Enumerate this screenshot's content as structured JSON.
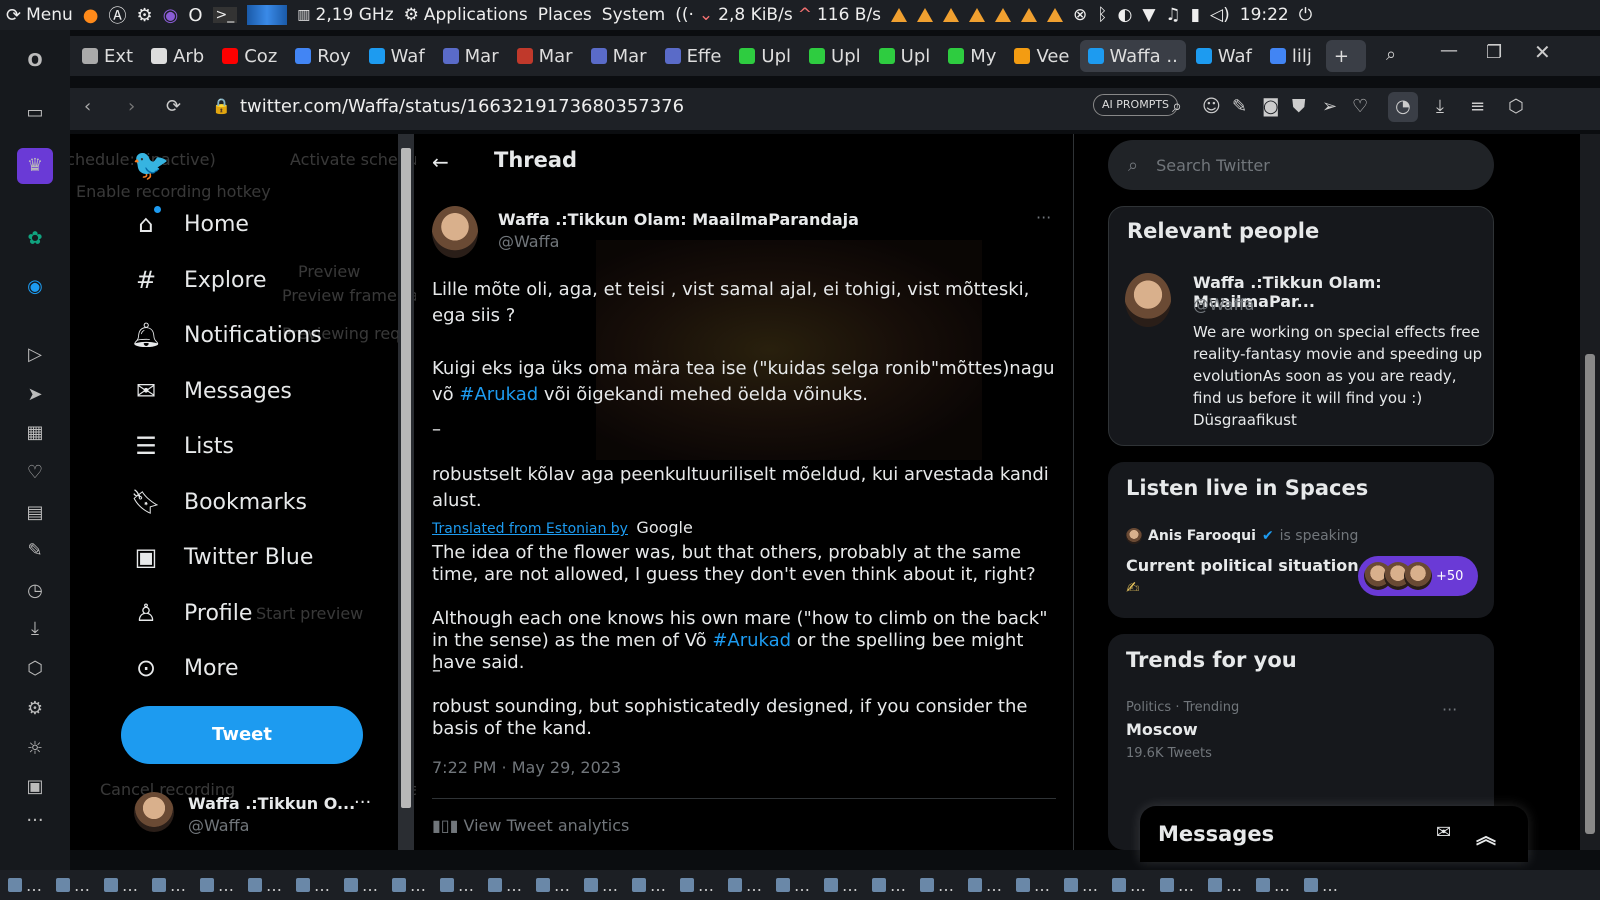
{
  "system_panel": {
    "menu_label": "Menu",
    "cpu_freq": "2,19 GHz",
    "applications_label": "Applications",
    "places_label": "Places",
    "system_label": "System",
    "net_down": "2,8 KiB/s",
    "net_up": "116 B/s",
    "clock": "19:22"
  },
  "browser": {
    "tabs": [
      {
        "label": "Ext",
        "color": "#aaaaaa"
      },
      {
        "label": "Arb",
        "color": "#dddddd"
      },
      {
        "label": "Coz",
        "color": "#ff0000"
      },
      {
        "label": "Roy",
        "color": "#4285f4"
      },
      {
        "label": "Waf",
        "color": "#1d9bf0"
      },
      {
        "label": "Mar",
        "color": "#5a6bc8"
      },
      {
        "label": "Mar",
        "color": "#c0392b"
      },
      {
        "label": "Mar",
        "color": "#5a6bc8"
      },
      {
        "label": "Effe",
        "color": "#5a6bc8"
      },
      {
        "label": "Upl",
        "color": "#2ecc40"
      },
      {
        "label": "Upl",
        "color": "#2ecc40"
      },
      {
        "label": "Upl",
        "color": "#2ecc40"
      },
      {
        "label": "My",
        "color": "#2ecc40"
      },
      {
        "label": "Vee",
        "color": "#f39c12"
      },
      {
        "label": "Waffa ..",
        "color": "#1d9bf0",
        "active": true
      },
      {
        "label": "Waf",
        "color": "#1d9bf0"
      },
      {
        "label": "lilj",
        "color": "#4285f4"
      }
    ],
    "url": "twitter.com/Waffa/status/1663219173680357376",
    "ai_prompts_label": "AI PROMPTS"
  },
  "twitter": {
    "nav": [
      {
        "label": "Home",
        "icon": "home-icon"
      },
      {
        "label": "Explore",
        "icon": "hashtag-icon"
      },
      {
        "label": "Notifications",
        "icon": "bell-icon"
      },
      {
        "label": "Messages",
        "icon": "envelope-icon"
      },
      {
        "label": "Lists",
        "icon": "list-icon"
      },
      {
        "label": "Bookmarks",
        "icon": "bookmark-icon"
      },
      {
        "label": "Twitter Blue",
        "icon": "twitter-blue-icon"
      },
      {
        "label": "Profile",
        "icon": "person-icon"
      },
      {
        "label": "More",
        "icon": "more-circle-icon"
      }
    ],
    "tweet_button": "Tweet",
    "account": {
      "name": "Waffa .:Tikkun O...",
      "handle": "@Waffa"
    },
    "thread": {
      "header": "Thread",
      "author_name": "Waffa .:Tikkun Olam: MaailmaParandaja",
      "author_handle": "@Waffa",
      "para1": "Lille mõte oli, aga, et teisi , vist samal ajal, ei tohigi, vist mõtteski, ega siis ?",
      "para2_before": "Kuigi eks iga üks oma mära tea ise (\"kuidas selga ronib\"mõttes)nagu võ ",
      "para2_hashtag": "#Arukad",
      "para2_after": " või õigekandi mehed öelda võinuks.",
      "dash1": "–",
      "para3": "robustselt kõlav aga peenkultuuriliselt mõeldud, kui arvestada kandi alust.",
      "translated_label": "Translated from Estonian by",
      "google_label": "Google",
      "tr1": "The idea of the flower was, but that others, probably at the same time, are not allowed, I guess they don't even think about it, right?",
      "tr2_before": "Although each one knows his own mare (\"how to climb on the back\" in the sense) as the men of Võ ",
      "tr2_hashtag": "#Arukad",
      "tr2_after": " or the spelling bee might have said.",
      "dash2": "–",
      "tr3": "robust sounding, but sophisticatedly designed, if you consider the basis of the kand.",
      "timestamp": "7:22 PM · May 29, 2023",
      "analytics": "View Tweet analytics"
    },
    "search_placeholder": "Search Twitter",
    "relevant": {
      "title": "Relevant people",
      "name": "Waffa .:Tikkun Olam: MaailmaPar...",
      "handle": "@Waffa",
      "bio": "We are working on special effects free reality-fantasy movie and speeding up evolutionAs soon as you are ready, find us before it will find you :) Düsgraafikust"
    },
    "spaces": {
      "title": "Listen live in Spaces",
      "host": "Anis Farooqui",
      "speaking": "is speaking",
      "topic": "Current political situation",
      "emoji": "✍",
      "count": "+50"
    },
    "trends": {
      "title": "Trends for you",
      "category": "Politics · Trending",
      "name": "Moscow",
      "count": "19.6K Tweets"
    },
    "messages_drawer": "Messages"
  }
}
